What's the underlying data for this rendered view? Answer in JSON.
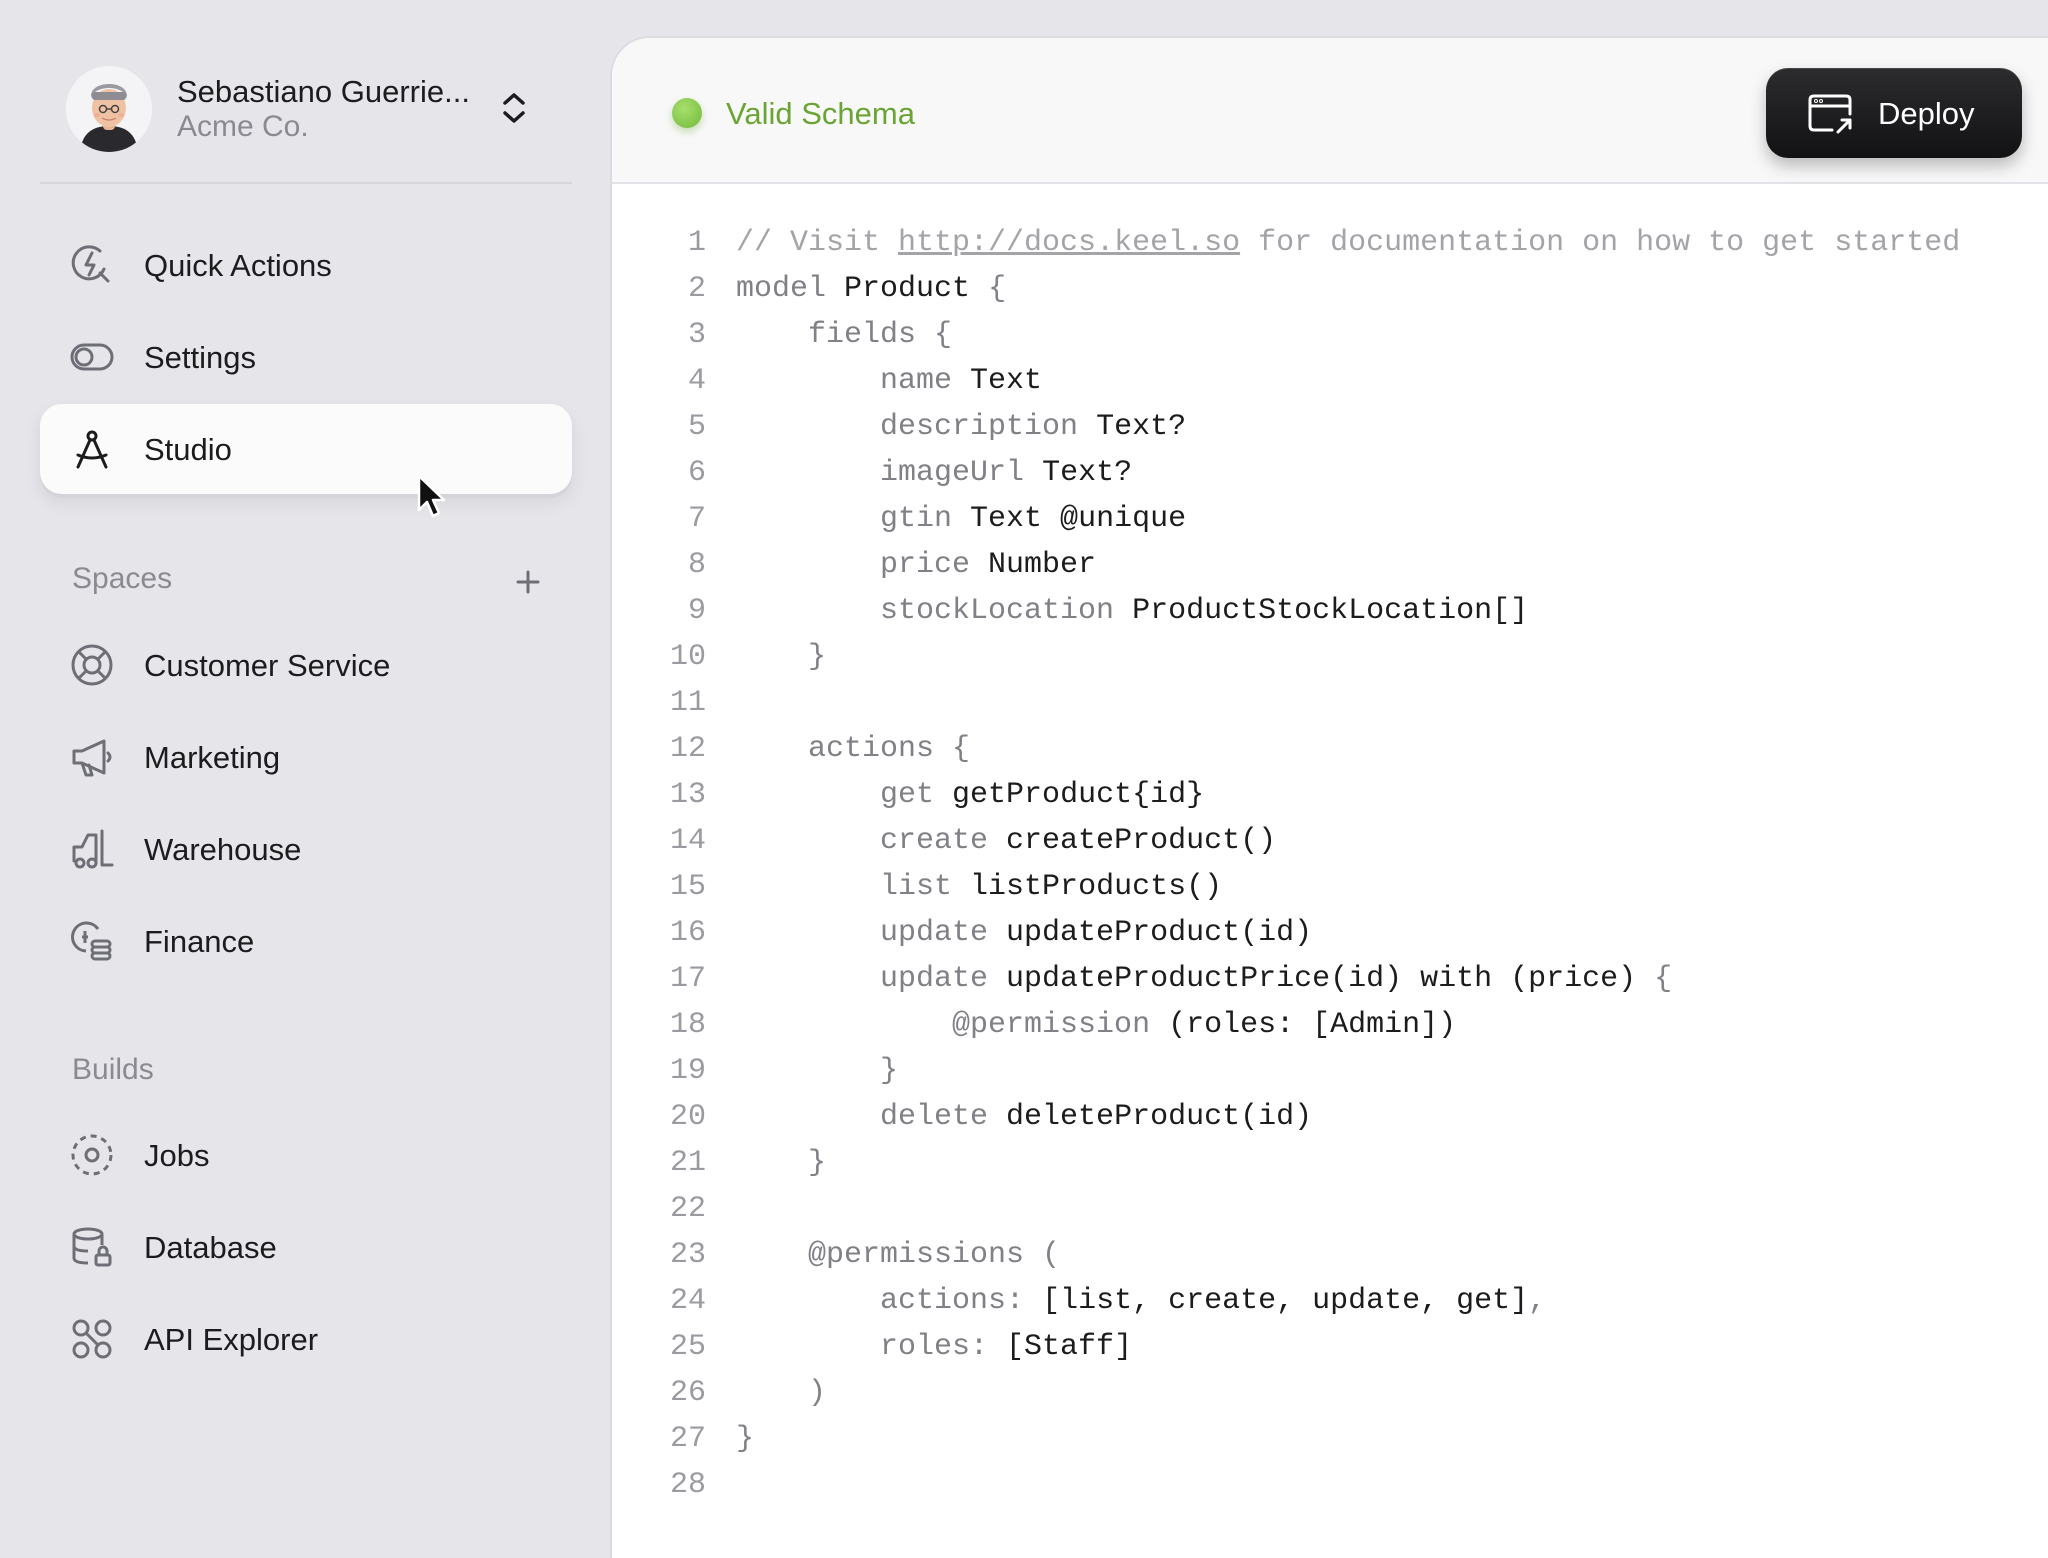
{
  "profile": {
    "name": "Sebastiano Guerrie...",
    "org": "Acme Co."
  },
  "nav": {
    "top": [
      {
        "label": "Quick Actions",
        "icon": "quick-actions-icon"
      },
      {
        "label": "Settings",
        "icon": "toggle-icon"
      },
      {
        "label": "Studio",
        "icon": "compass-icon",
        "active": true
      }
    ],
    "spaces_title": "Spaces",
    "spaces": [
      {
        "label": "Customer Service",
        "icon": "lifebuoy-icon"
      },
      {
        "label": "Marketing",
        "icon": "megaphone-icon"
      },
      {
        "label": "Warehouse",
        "icon": "forklift-icon"
      },
      {
        "label": "Finance",
        "icon": "coins-icon"
      }
    ],
    "builds_title": "Builds",
    "builds": [
      {
        "label": "Jobs",
        "icon": "jobs-icon"
      },
      {
        "label": "Database",
        "icon": "database-lock-icon"
      },
      {
        "label": "API Explorer",
        "icon": "api-icon"
      }
    ]
  },
  "editor": {
    "status": "Valid Schema",
    "status_color": "#7ab940",
    "deploy_label": "Deploy",
    "lines": [
      [
        [
          "// Visit ",
          "c"
        ],
        [
          "http://docs.keel.so",
          "u"
        ],
        [
          " for documentation on how to get started",
          "c"
        ]
      ],
      [
        [
          "model ",
          "k"
        ],
        [
          "Product ",
          "n"
        ],
        [
          "{",
          "k"
        ]
      ],
      [
        [
          "    fields {",
          "k"
        ]
      ],
      [
        [
          "        name ",
          "k"
        ],
        [
          "Text",
          "n"
        ]
      ],
      [
        [
          "        description ",
          "k"
        ],
        [
          "Text?",
          "n"
        ]
      ],
      [
        [
          "        imageUrl ",
          "k"
        ],
        [
          "Text?",
          "n"
        ]
      ],
      [
        [
          "        gtin ",
          "k"
        ],
        [
          "Text @unique",
          "n"
        ]
      ],
      [
        [
          "        price ",
          "k"
        ],
        [
          "Number",
          "n"
        ]
      ],
      [
        [
          "        stockLocation ",
          "k"
        ],
        [
          "ProductStockLocation[]",
          "n"
        ]
      ],
      [
        [
          "    }",
          "k"
        ]
      ],
      [],
      [
        [
          "    actions {",
          "k"
        ]
      ],
      [
        [
          "        get ",
          "k"
        ],
        [
          "getProduct{id}",
          "n"
        ]
      ],
      [
        [
          "        create ",
          "k"
        ],
        [
          "createProduct()",
          "n"
        ]
      ],
      [
        [
          "        list ",
          "k"
        ],
        [
          "listProducts()",
          "n"
        ]
      ],
      [
        [
          "        update ",
          "k"
        ],
        [
          "updateProduct(id)",
          "n"
        ]
      ],
      [
        [
          "        update ",
          "k"
        ],
        [
          "updateProductPrice(id) with (price) ",
          "n"
        ],
        [
          "{",
          "k"
        ]
      ],
      [
        [
          "            @permission ",
          "k"
        ],
        [
          "(roles: [Admin])",
          "n"
        ]
      ],
      [
        [
          "        }",
          "k"
        ]
      ],
      [
        [
          "        delete ",
          "k"
        ],
        [
          "deleteProduct(id)",
          "n"
        ]
      ],
      [
        [
          "    }",
          "k"
        ]
      ],
      [],
      [
        [
          "    @permissions (",
          "k"
        ]
      ],
      [
        [
          "        actions: ",
          "k"
        ],
        [
          "[list, create, update, get]",
          "n"
        ],
        [
          ",",
          "k"
        ]
      ],
      [
        [
          "        roles: ",
          "k"
        ],
        [
          "[Staff]",
          "n"
        ]
      ],
      [
        [
          "    )",
          "k"
        ]
      ],
      [
        [
          "}",
          "k"
        ]
      ],
      []
    ]
  }
}
